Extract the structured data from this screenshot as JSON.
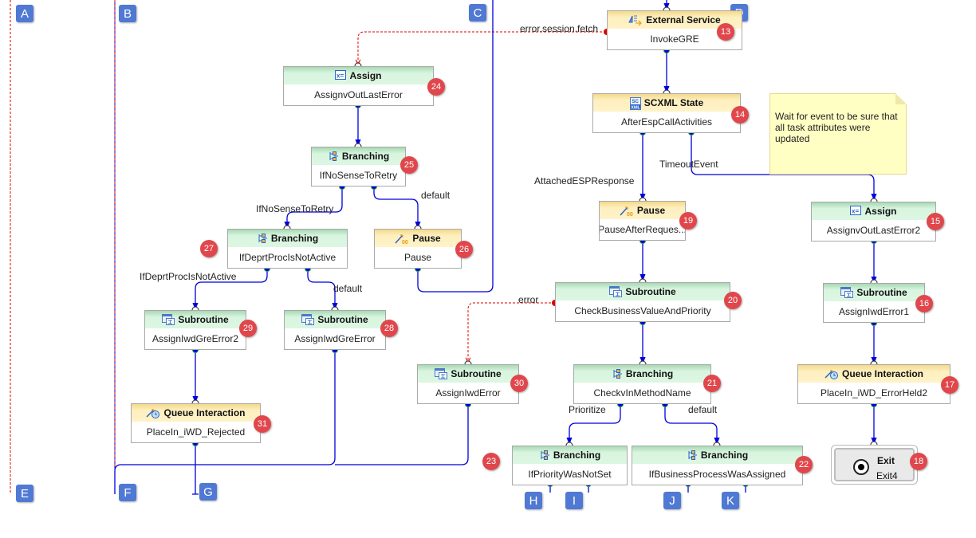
{
  "diagram": {
    "markers": [
      "A",
      "B",
      "C",
      "D",
      "E",
      "F",
      "G",
      "H",
      "I",
      "J",
      "K"
    ],
    "nodes": [
      {
        "id": "n13",
        "type": "External Service",
        "name": "InvokeGRE",
        "badge": "13",
        "style": "yellow",
        "icon": "external-service-icon"
      },
      {
        "id": "n14",
        "type": "SCXML State",
        "name": "AfterEspCallActivities",
        "badge": "14",
        "style": "yellow",
        "icon": "scxml-icon"
      },
      {
        "id": "n15",
        "type": "Assign",
        "name": "AssignvOutLastError2",
        "badge": "15",
        "style": "green",
        "icon": "assign-icon"
      },
      {
        "id": "n16",
        "type": "Subroutine",
        "name": "AssignIwdError1",
        "badge": "16",
        "style": "green",
        "icon": "subroutine-icon"
      },
      {
        "id": "n17",
        "type": "Queue Interaction",
        "name": "PlaceIn_iWD_ErrorHeld2",
        "badge": "17",
        "style": "yellow",
        "icon": "queue-interaction-icon"
      },
      {
        "id": "n18",
        "type": "Exit",
        "name": "Exit4",
        "badge": "18",
        "style": "exit",
        "icon": "exit-icon"
      },
      {
        "id": "n19",
        "type": "Pause",
        "name": "PauseAfterReques...",
        "badge": "19",
        "style": "yellow",
        "icon": "pause-icon"
      },
      {
        "id": "n20",
        "type": "Subroutine",
        "name": "CheckBusinessValueAndPriority",
        "badge": "20",
        "style": "green",
        "icon": "subroutine-icon"
      },
      {
        "id": "n21",
        "type": "Branching",
        "name": "CheckvInMethodName",
        "badge": "21",
        "style": "green",
        "icon": "branching-icon"
      },
      {
        "id": "n22",
        "type": "Branching",
        "name": "IfBusinessProcessWasAssigned",
        "badge": "22",
        "style": "green",
        "icon": "branching-icon"
      },
      {
        "id": "n23",
        "type": "Branching",
        "name": "IfPriorityWasNotSet",
        "badge": "23",
        "style": "green",
        "icon": "branching-icon"
      },
      {
        "id": "n24",
        "type": "Assign",
        "name": "AssignvOutLastError",
        "badge": "24",
        "style": "green",
        "icon": "assign-icon"
      },
      {
        "id": "n25",
        "type": "Branching",
        "name": "IfNoSenseToRetry",
        "badge": "25",
        "style": "green",
        "icon": "branching-icon"
      },
      {
        "id": "n26",
        "type": "Pause",
        "name": "Pause",
        "badge": "26",
        "style": "yellow",
        "icon": "pause-icon"
      },
      {
        "id": "n27",
        "type": "Branching",
        "name": "IfDeprtProcIsNotActive",
        "badge": "27",
        "style": "green",
        "icon": "branching-icon"
      },
      {
        "id": "n28",
        "type": "Subroutine",
        "name": "AssignIwdGreError",
        "badge": "28",
        "style": "green",
        "icon": "subroutine-icon"
      },
      {
        "id": "n29",
        "type": "Subroutine",
        "name": "AssignIwdGreError2",
        "badge": "29",
        "style": "green",
        "icon": "subroutine-icon"
      },
      {
        "id": "n30",
        "type": "Subroutine",
        "name": "AssignIwdError",
        "badge": "30",
        "style": "green",
        "icon": "subroutine-icon"
      },
      {
        "id": "n31",
        "type": "Queue Interaction",
        "name": "PlaceIn_iWD_Rejected",
        "badge": "31",
        "style": "yellow",
        "icon": "queue-interaction-icon"
      }
    ],
    "edge_labels": {
      "error_session_fetch": "error.session.fetch",
      "attached_esp_response": "AttachedESPResponse",
      "timeout_event": "TimeoutEvent",
      "if_no_sense_to_retry": "IfNoSenseToRetry",
      "default_25": "default",
      "if_deprt_proc_is_not_active": "IfDeprtProcIsNotActive",
      "default_27": "default",
      "error_20": "error",
      "prioritize": "Prioritize",
      "default_21": "default"
    },
    "note": {
      "text": "Wait for event to be sure that all task attributes were updated"
    },
    "colors": {
      "wire": "#0000dd",
      "error_wire": "#e00000",
      "badge": "#e0474c",
      "marker": "#4f79d3",
      "green_header": "#dcf6e2",
      "yellow_header": "#fff2c8"
    }
  }
}
